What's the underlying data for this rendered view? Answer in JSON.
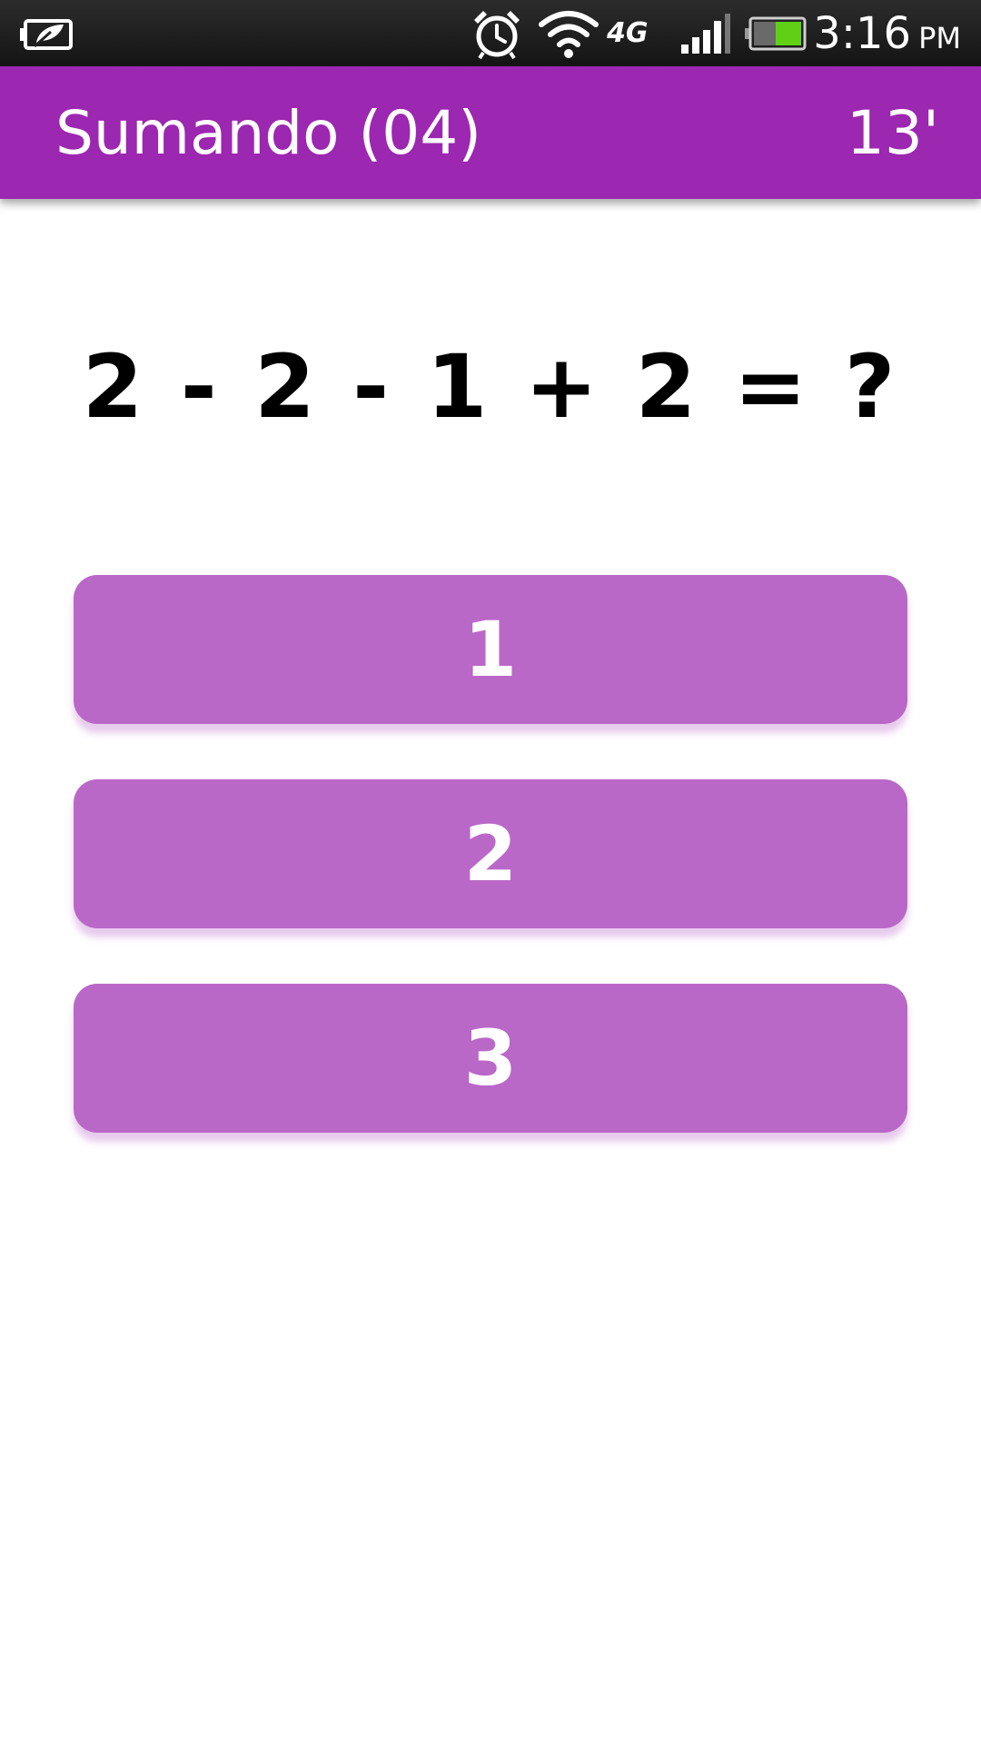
{
  "status_bar": {
    "time": "3:16",
    "ampm": "PM",
    "network": "4G",
    "icons": [
      "power-saver-icon",
      "alarm-icon",
      "wifi-icon",
      "network-4g-icon",
      "signal-icon",
      "battery-icon"
    ]
  },
  "app_bar": {
    "title": "Sumando (04)",
    "timer": "13'"
  },
  "question": {
    "text": "2 - 2 - 1 + 2 = ?"
  },
  "answers": [
    {
      "label": "1"
    },
    {
      "label": "2"
    },
    {
      "label": "3"
    }
  ],
  "colors": {
    "app_bar": "#9c27b0",
    "answer_button": "#ba68c8",
    "battery_level": "#5fd014"
  }
}
